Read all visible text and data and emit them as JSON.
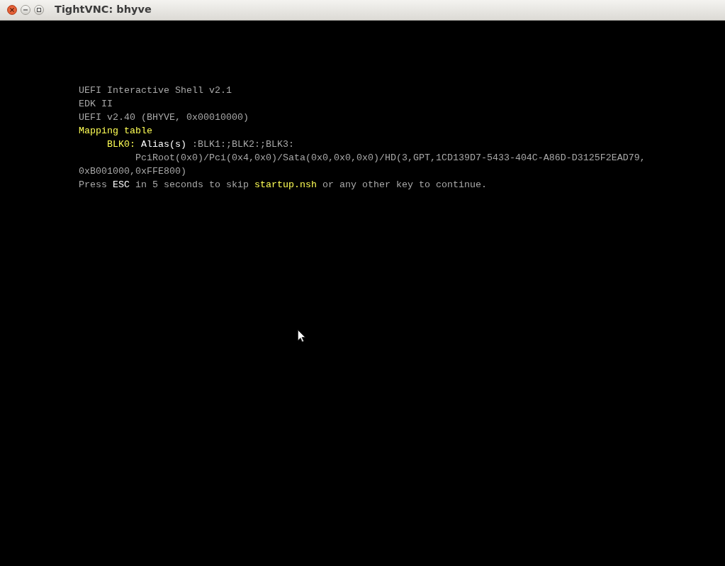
{
  "window": {
    "title": "TightVNC: bhyve"
  },
  "console": {
    "lines": [
      {
        "segments": [
          {
            "text": "UEFI Interactive Shell v2.1",
            "color": "#a8a8a8"
          }
        ]
      },
      {
        "segments": [
          {
            "text": "EDK II",
            "color": "#a8a8a8"
          }
        ]
      },
      {
        "segments": [
          {
            "text": "UEFI v2.40 (BHYVE, 0x00010000)",
            "color": "#a8a8a8"
          }
        ]
      },
      {
        "segments": [
          {
            "text": "Mapping table",
            "color": "#ffff55"
          }
        ],
        "children": [
          {
            "segments": [
              {
                "text": "BLK0:",
                "color": "#ffff55"
              },
              {
                "text": "Alias(s)",
                "color": "#ffffff"
              },
              {
                "text": ":BLK1:;BLK2:;BLK3:",
                "color": "#a8a8a8"
              }
            ],
            "children": [
              {
                "segments": [
                  {
                    "text": "PciRoot(0x0)/Pci(0x4,0x0)/Sata(0x0,0x0,0x0)/HD(3,GPT,1CD139D7-5433-404C-A86D-D3125F2EAD79,",
                    "color": "#a8a8a8"
                  }
                ]
              }
            ]
          }
        ]
      },
      {
        "segments": [
          {
            "text": "0xB001000,0xFFE800)",
            "color": "#a8a8a8"
          }
        ]
      },
      {
        "segments": [
          {
            "text": "Press",
            "color": "#a8a8a8"
          },
          {
            "text": "ESC",
            "color": "#ffffff"
          },
          {
            "text": "in 5 seconds to skip",
            "color": "#a8a8a8"
          },
          {
            "text": "startup.nsh",
            "color": "#ffff55"
          },
          {
            "text": "or any other key to continue.",
            "color": "#a8a8a8"
          }
        ]
      }
    ]
  }
}
